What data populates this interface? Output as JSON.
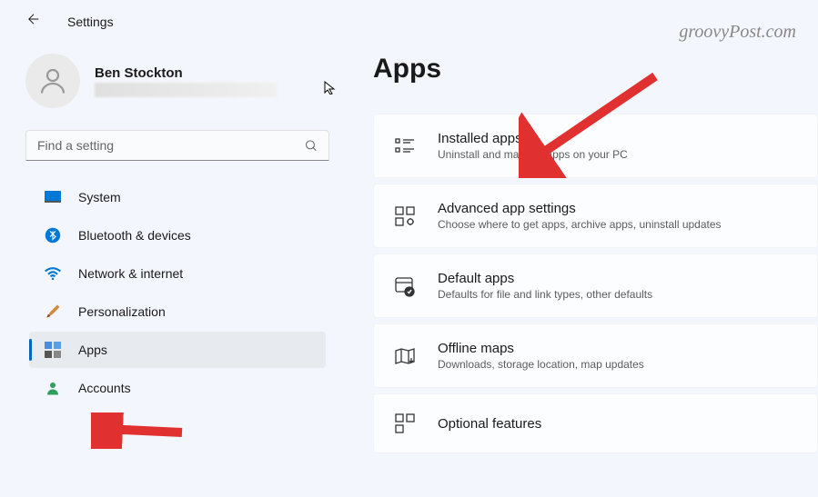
{
  "header": {
    "title": "Settings"
  },
  "profile": {
    "name": "Ben Stockton"
  },
  "search": {
    "placeholder": "Find a setting"
  },
  "sidebar": {
    "items": [
      {
        "label": "System"
      },
      {
        "label": "Bluetooth & devices"
      },
      {
        "label": "Network & internet"
      },
      {
        "label": "Personalization"
      },
      {
        "label": "Apps"
      },
      {
        "label": "Accounts"
      }
    ]
  },
  "main": {
    "title": "Apps",
    "cards": [
      {
        "title": "Installed apps",
        "desc": "Uninstall and manage apps on your PC"
      },
      {
        "title": "Advanced app settings",
        "desc": "Choose where to get apps, archive apps, uninstall updates"
      },
      {
        "title": "Default apps",
        "desc": "Defaults for file and link types, other defaults"
      },
      {
        "title": "Offline maps",
        "desc": "Downloads, storage location, map updates"
      },
      {
        "title": "Optional features",
        "desc": ""
      }
    ]
  },
  "watermark": "groovyPost.com"
}
